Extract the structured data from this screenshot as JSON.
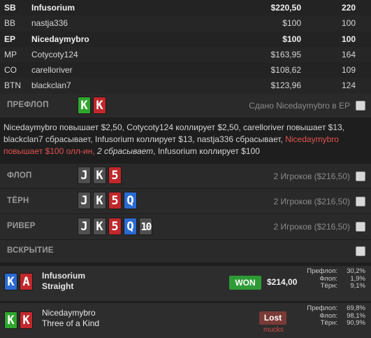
{
  "players": [
    {
      "pos": "SB",
      "name": "Infusorium",
      "amount": "$220,50",
      "chips": "220",
      "bold": true
    },
    {
      "pos": "BB",
      "name": "nastja336",
      "amount": "$100",
      "chips": "100",
      "bold": false
    },
    {
      "pos": "EP",
      "name": "Nicedaymybro",
      "amount": "$100",
      "chips": "100",
      "bold": true
    },
    {
      "pos": "MP",
      "name": "Cotycoty124",
      "amount": "$163,95",
      "chips": "164",
      "bold": false
    },
    {
      "pos": "CO",
      "name": "carelloriver",
      "amount": "$108,62",
      "chips": "109",
      "bold": false
    },
    {
      "pos": "BTN",
      "name": "blackclan7",
      "amount": "$123,96",
      "chips": "124",
      "bold": false
    }
  ],
  "preflop": {
    "label": "ПРЕФЛОП",
    "cards": [
      "K",
      "K"
    ],
    "info": "Сдано Nicedaymybro в EP"
  },
  "actions": {
    "line1": "Nicedaymybro повышает $2,50, Cotycoty124 коллирует $2,50, carelloriver повышает $13,",
    "line2a": "blackclan7 сбрасывает, Infusorium коллирует $13, nastja336 сбрасывает, ",
    "line2b": "Nicedaymybro",
    "line3a": "повышает $100 олл-ин, ",
    "line3b": "2 сбрасывает",
    "line3c": ", Infusorium коллирует $100"
  },
  "flop": {
    "label": "ФЛОП",
    "cards": [
      "J",
      "K",
      "5"
    ],
    "info": "2 Игроков ($216,50)"
  },
  "turn": {
    "label": "ТЁРН",
    "cards": [
      "J",
      "K",
      "5",
      "Q"
    ],
    "info": "2 Игроков ($216,50)"
  },
  "river": {
    "label": "РИВЕР",
    "cards": [
      "J",
      "K",
      "5",
      "Q",
      "10"
    ],
    "info": "2 Игроков ($216,50)"
  },
  "showdown": {
    "label": "ВСКРЫТИЕ"
  },
  "results": [
    {
      "cards": [
        "K",
        "A"
      ],
      "name": "Infusorium",
      "hand": "Straight",
      "badge": "WON",
      "amount": "$214,00",
      "equity": [
        {
          "label": "Префлоп:",
          "value": "30,2%"
        },
        {
          "label": "Флоп:",
          "value": "1,9%"
        },
        {
          "label": "Тёрн:",
          "value": "9,1%"
        }
      ]
    },
    {
      "cards": [
        "K",
        "K"
      ],
      "name": "Nicedaymybro",
      "hand": "Three of a Kind",
      "badge": "Lost",
      "note": "mucks",
      "equity": [
        {
          "label": "Префлоп:",
          "value": "69,8%"
        },
        {
          "label": "Флоп:",
          "value": "98,1%"
        },
        {
          "label": "Тёрн:",
          "value": "90,9%"
        }
      ]
    }
  ],
  "colors": {
    "won": "#2e9b36",
    "lost": "#7a3a36",
    "highlight": "#e2534f",
    "card_red": "#c0282b",
    "card_blue": "#2b6bd1",
    "card_green": "#30a62f",
    "card_grey": "#4f4f4f"
  }
}
